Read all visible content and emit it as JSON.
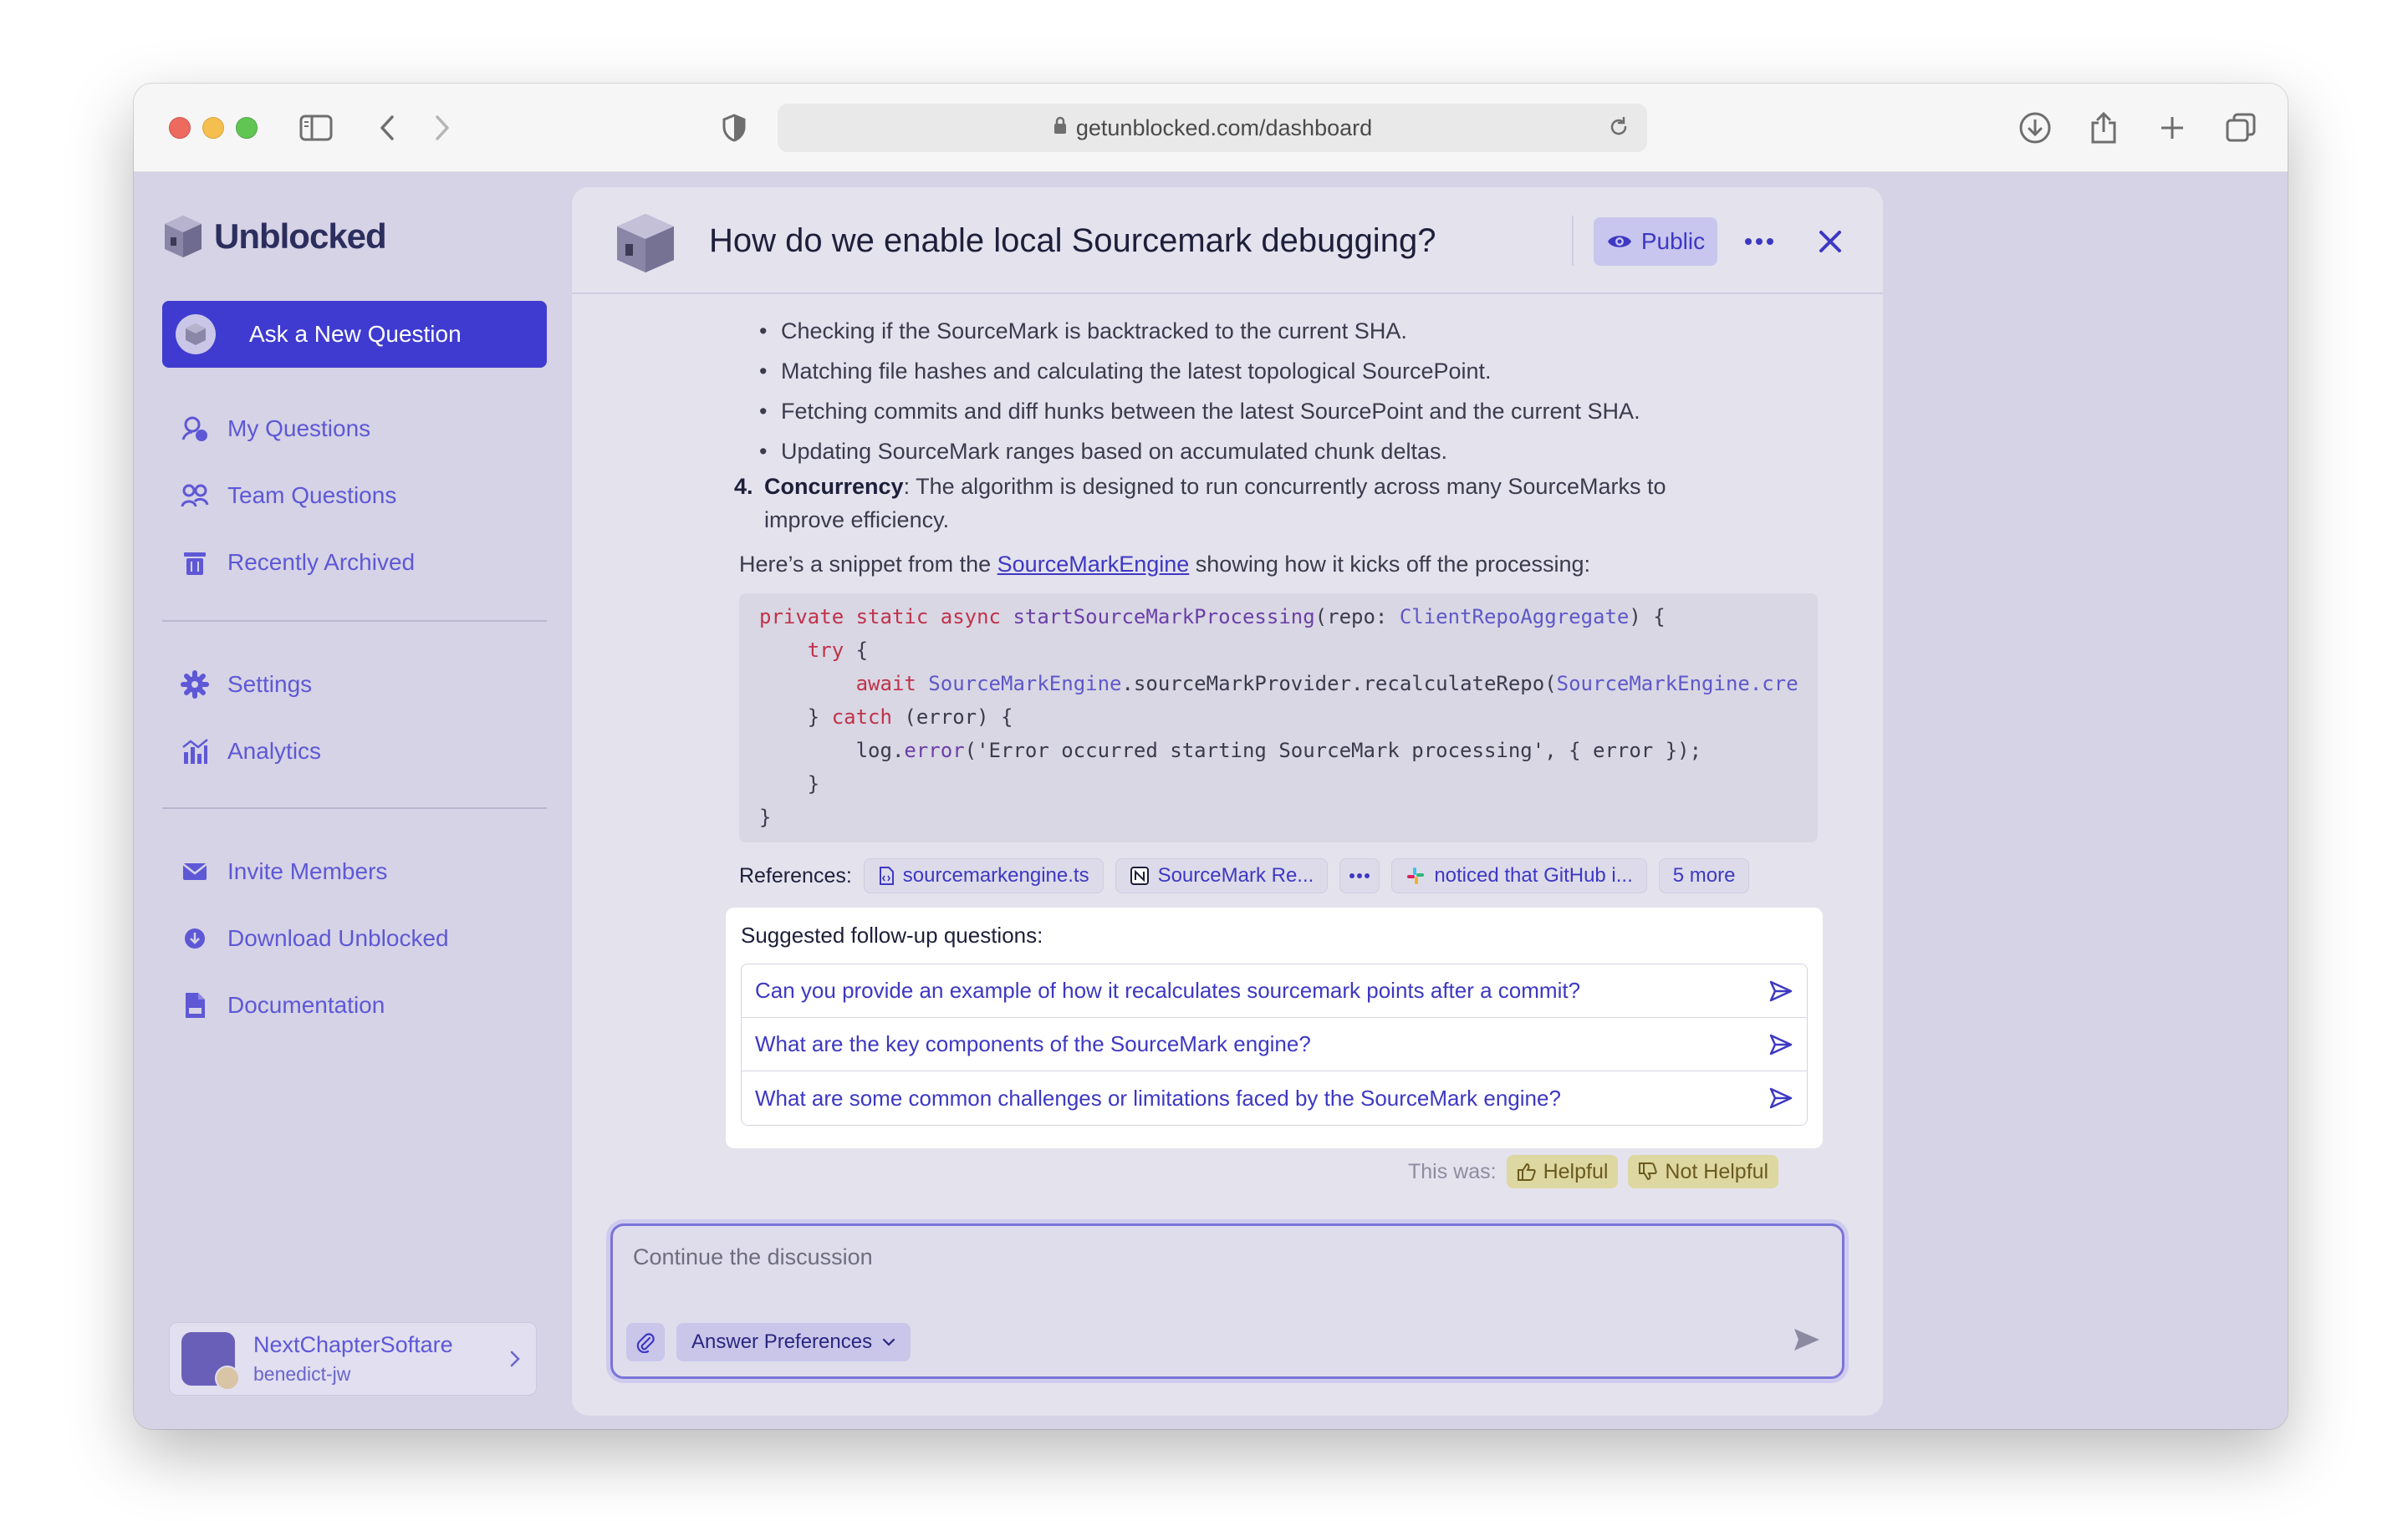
{
  "browser": {
    "url": "getunblocked.com/dashboard"
  },
  "sidebar": {
    "brand": "Unblocked",
    "ask_button": "Ask a New Question",
    "items": [
      {
        "label": "My Questions",
        "icon": "user-question-icon"
      },
      {
        "label": "Team Questions",
        "icon": "team-icon"
      },
      {
        "label": "Recently Archived",
        "icon": "trash-icon"
      },
      {
        "label": "Settings",
        "icon": "gear-icon"
      },
      {
        "label": "Analytics",
        "icon": "analytics-icon"
      },
      {
        "label": "Invite Members",
        "icon": "envelope-icon"
      },
      {
        "label": "Download Unblocked",
        "icon": "download-icon"
      },
      {
        "label": "Documentation",
        "icon": "doc-icon"
      }
    ],
    "account": {
      "team": "NextChapterSoftare",
      "user": "benedict-jw"
    }
  },
  "question": {
    "title": "How do we enable local Sourcemark debugging?",
    "visibility": "Public"
  },
  "answer": {
    "bullets": [
      "Checking if the SourceMark is backtracked to the current SHA.",
      "Matching file hashes and calculating the latest topological SourcePoint.",
      "Fetching commits and diff hunks between the latest SourcePoint and the current SHA.",
      "Updating SourceMark ranges based on accumulated chunk deltas."
    ],
    "point4": {
      "number": "4.",
      "heading": "Concurrency",
      "text": ": The algorithm is designed to run concurrently across many SourceMarks to improve efficiency."
    },
    "snippet_intro_before": "Here’s a snippet from the ",
    "snippet_link": "SourceMarkEngine",
    "snippet_intro_after": " showing how it kicks off the processing:",
    "code": {
      "l1_kw": "private static async ",
      "l1_fn": "startSourceMarkProcessing",
      "l1_rest": "(repo: ",
      "l1_ty": "ClientRepoAggregate",
      "l1_end": ") {",
      "l2_kw": "try",
      "l2_end": " {",
      "l3_kw": "await ",
      "l3_ty": "SourceMarkEngine",
      "l3_mid": ".sourceMarkProvider.recalculateRepo(",
      "l3_ty2": "SourceMarkEngine.cre",
      "l4_pre": "} ",
      "l4_kw": "catch",
      "l4_end": " (error) {",
      "l5_pre": "log.",
      "l5_fn": "error",
      "l5_end": "('Error occurred starting SourceMark processing', { error });",
      "l6": "}",
      "l7": "}"
    },
    "references": {
      "label": "References:",
      "items": [
        {
          "label": "sourcemarkengine.ts",
          "icon": "file-code-icon"
        },
        {
          "label": "SourceMark Re...",
          "icon": "notion-icon"
        },
        {
          "label": "noticed that GitHub i...",
          "icon": "slack-icon"
        }
      ],
      "more": "5 more"
    },
    "followups": {
      "title": "Suggested follow-up questions:",
      "items": [
        "Can you provide an example of how it recalculates sourcemark points after a commit?",
        "What are the key components of the SourceMark engine?",
        "What are some common challenges or limitations faced by the SourceMark engine?"
      ]
    },
    "feedback": {
      "label": "This was:",
      "helpful": "Helpful",
      "not_helpful": "Not Helpful"
    }
  },
  "composer": {
    "placeholder": "Continue the discussion",
    "preferences": "Answer Preferences"
  },
  "colors": {
    "accent": "#3f3bd0",
    "sidebar_text": "#5e58d6",
    "background": "#d6d3e6"
  }
}
